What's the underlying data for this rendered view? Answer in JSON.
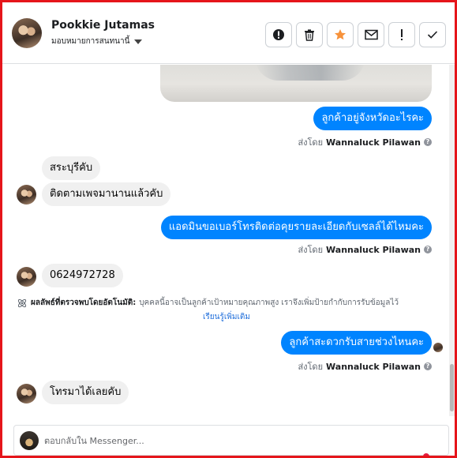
{
  "header": {
    "contact_name": "Pookkie Jutamas",
    "assign_label": "มอบหมายการสนทนานี้",
    "actions": [
      {
        "name": "report-spam-button",
        "icon": "alert-circle-icon"
      },
      {
        "name": "delete-button",
        "icon": "trash-icon"
      },
      {
        "name": "star-button",
        "icon": "star-icon"
      },
      {
        "name": "mark-unread-button",
        "icon": "envelope-icon"
      },
      {
        "name": "follow-up-button",
        "icon": "exclamation-icon"
      },
      {
        "name": "mark-done-button",
        "icon": "checkmark-icon"
      }
    ],
    "star_color": "#f7923b"
  },
  "messages": {
    "out1": "ลูกค้าอยู่จังหวัดอะไรคะ",
    "sent_by_1_prefix": "ส่งโดย",
    "sent_by_1_agent": "Wannaluck Pilawan",
    "in1": "สระบุรีคับ",
    "in2": "ติดตามเพจมานานแล้วคับ",
    "out2": "แอดมินขอเบอร์โทรติดต่อคุยรายละเอียดกับเซลล์ได้ไหมคะ",
    "sent_by_2_prefix": "ส่งโดย",
    "sent_by_2_agent": "Wannaluck Pilawan",
    "in3": "0624972728",
    "auto_title": "ผลลัพธ์ที่ตรวจพบโดยอัตโนมัติ:",
    "auto_text": "บุคคลนี้อาจเป็นลูกค้าเป้าหมายคุณภาพสูง เราจึงเพิ่มป้ายกำกับการรับข้อมูลไว้",
    "learn_more": "เรียนรู้เพิ่มเติม",
    "out3": "ลูกค้าสะดวกรับสายช่วงไหนคะ",
    "sent_by_3_prefix": "ส่งโดย",
    "sent_by_3_agent": "Wannaluck Pilawan",
    "in4": "โทรมาได้เลยคับ"
  },
  "composer": {
    "placeholder": "ตอบกลับใน Messenger..."
  },
  "colors": {
    "outgoing_bubble": "#0084ff",
    "incoming_bubble": "#f0f0f0",
    "frame_border": "#e5151b",
    "link": "#216fdb"
  }
}
